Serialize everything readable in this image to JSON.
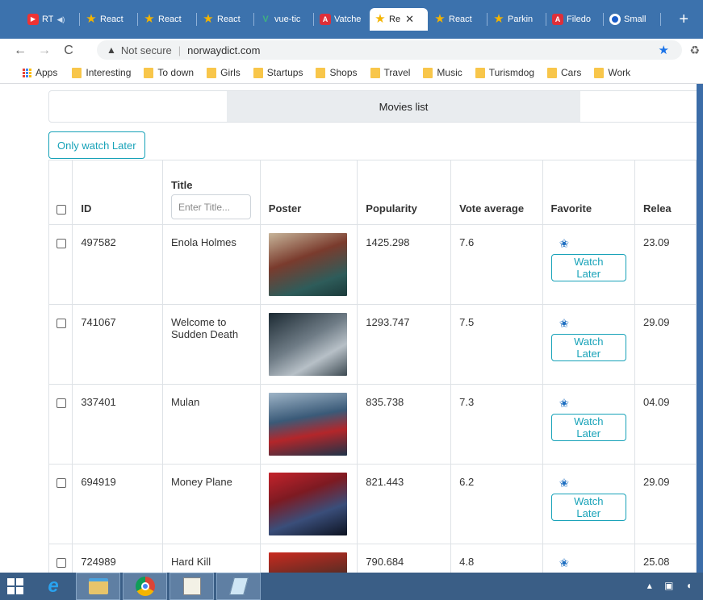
{
  "browser": {
    "tabs": [
      {
        "label": "RT",
        "icon": "youtube-icon",
        "active": false
      },
      {
        "label": "React",
        "icon": "star-icon",
        "active": false
      },
      {
        "label": "React",
        "icon": "star-icon",
        "active": false
      },
      {
        "label": "React",
        "icon": "star-icon",
        "active": false
      },
      {
        "label": "vue-tic",
        "icon": "vue-icon",
        "active": false
      },
      {
        "label": "Vatche",
        "icon": "angular-icon",
        "active": false
      },
      {
        "label": "Re",
        "icon": "star-icon",
        "active": true
      },
      {
        "label": "React",
        "icon": "star-icon",
        "active": false
      },
      {
        "label": "Parkin",
        "icon": "star-icon",
        "active": false
      },
      {
        "label": "Filedo",
        "icon": "angular-icon",
        "active": false
      },
      {
        "label": "Small",
        "icon": "circle-icon",
        "active": false
      }
    ],
    "address": {
      "security": "Not secure",
      "url": "norwaydict.com"
    },
    "bookmarks": [
      "Interesting",
      "To down",
      "Girls",
      "Startups",
      "Shops",
      "Travel",
      "Music",
      "Turismdog",
      "Cars",
      "Work"
    ],
    "apps_label": "Apps"
  },
  "page": {
    "nav_tab": "Movies list",
    "filter_button": "Only watch Later",
    "columns": {
      "id": "ID",
      "title": "Title",
      "title_placeholder": "Enter Title...",
      "poster": "Poster",
      "popularity": "Popularity",
      "vote": "Vote average",
      "favorite": "Favorite",
      "release": "Relea"
    },
    "watch_later_label": "Watch Later",
    "rows": [
      {
        "id": "497582",
        "title": "Enola Holmes",
        "popularity": "1425.298",
        "vote": "7.6",
        "release": "23.09"
      },
      {
        "id": "741067",
        "title": "Welcome to Sudden Death",
        "popularity": "1293.747",
        "vote": "7.5",
        "release": "29.09"
      },
      {
        "id": "337401",
        "title": "Mulan",
        "popularity": "835.738",
        "vote": "7.3",
        "release": "04.09"
      },
      {
        "id": "694919",
        "title": "Money Plane",
        "popularity": "821.443",
        "vote": "6.2",
        "release": "29.09"
      },
      {
        "id": "724989",
        "title": "Hard Kill",
        "popularity": "790.684",
        "vote": "4.8",
        "release": "25.08"
      }
    ]
  },
  "colors": {
    "accent": "#17a2b8",
    "star": "#1f6fc1",
    "titlebar": "#3c72ad"
  }
}
